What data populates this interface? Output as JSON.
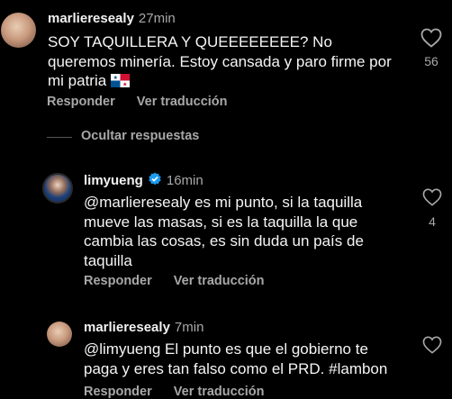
{
  "comments": [
    {
      "username": "marlieresealy",
      "time": "27min",
      "text": "SOY TAQUILLERA Y QUEEEEEEEE? No queremos minería. Estoy cansada y paro firme por mi patria",
      "likes": "56",
      "reply_label": "Responder",
      "translate_label": "Ver traducción"
    },
    {
      "username": "limyueng",
      "verified": true,
      "time": "16min",
      "text_lines": [
        "@marlieresealy es mi punto, si la taquilla",
        "mueve las masas, si es la taquilla la que",
        "cambia las cosas, es sin duda un país de",
        "taquilla"
      ],
      "likes": "4",
      "reply_label": "Responder",
      "translate_label": "Ver traducción"
    },
    {
      "username": "marlieresealy",
      "time": "7min",
      "text_lines": [
        "@limyueng El punto es que el gobierno te",
        "paga y eres tan falso como el PRD. #lambon"
      ],
      "reply_label": "Responder",
      "translate_label": "Ver traducción"
    }
  ],
  "hide_replies_label": "Ocultar respuestas",
  "icons": {
    "like": "heart-outline-icon",
    "verified": "verified-badge-icon",
    "flag": "panama-flag-emoji"
  },
  "colors": {
    "background": "#000000",
    "text": "#f5f5f5",
    "muted": "#a8a8a8",
    "verified": "#1d9bf0"
  }
}
